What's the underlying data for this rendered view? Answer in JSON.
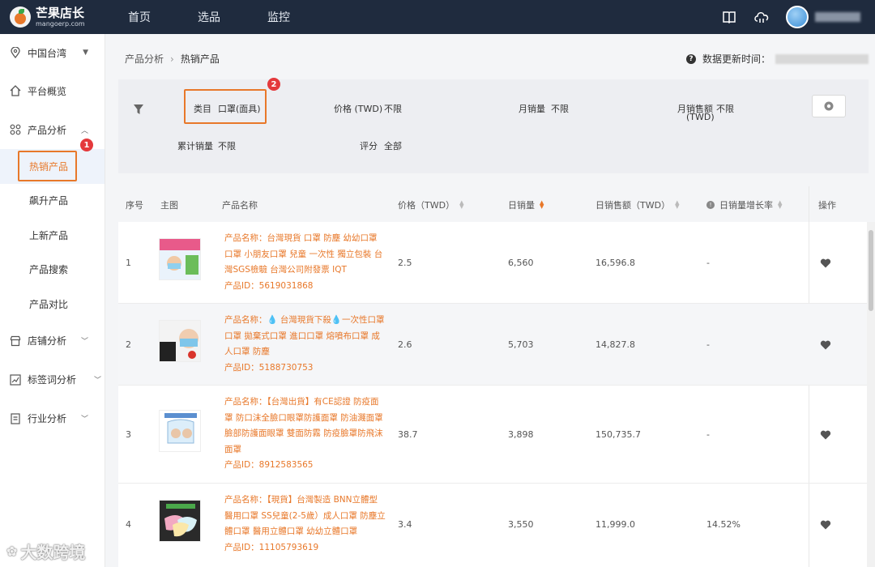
{
  "app": {
    "logo_cn": "芒果店长",
    "logo_en": "mangoerp.com",
    "nav": [
      "首页",
      "选品",
      "监控"
    ]
  },
  "sidebar": {
    "region": "中国台湾",
    "items": [
      {
        "label": "平台概览",
        "icon": "home-icon"
      },
      {
        "label": "产品分析",
        "icon": "grid-icon"
      },
      {
        "label": "店铺分析",
        "icon": "shop-icon"
      },
      {
        "label": "标签词分析",
        "icon": "chart-icon"
      },
      {
        "label": "行业分析",
        "icon": "report-icon"
      }
    ],
    "sub_items": [
      "热销产品",
      "飙升产品",
      "上新产品",
      "产品搜索",
      "产品对比"
    ]
  },
  "annotations": {
    "badge1": "1",
    "badge2": "2"
  },
  "breadcrumb": {
    "parent": "产品分析",
    "current": "热销产品"
  },
  "update_label": "数据更新时间：",
  "filters": {
    "category_label": "类目",
    "category_value": "口罩(面具)",
    "price_label": "价格 (TWD)",
    "price_value": "不限",
    "monthly_sales_label": "月销量",
    "monthly_sales_value": "不限",
    "monthly_revenue_label": "月销售额",
    "monthly_revenue_unit": "(TWD)",
    "monthly_revenue_value": "不限",
    "total_sales_label": "累计销量",
    "total_sales_value": "不限",
    "rating_label": "评分",
    "rating_value": "全部"
  },
  "table": {
    "headers": {
      "index": "序号",
      "image": "主图",
      "name": "产品名称",
      "price": "价格（TWD）",
      "daily_sales": "日销量",
      "daily_revenue": "日销售额（TWD）",
      "growth": "日销量增长率",
      "action": "操作"
    },
    "rows": [
      {
        "index": "1",
        "name_lines": [
          "产品名称：台灣現貨 口罩 防塵 幼幼口罩",
          "口罩 小朋友口罩 兒童 一次性 獨立包裝 台",
          "灣SGS檢驗 台灣公司附發票 IQT"
        ],
        "product_id": "产品ID：5619031868",
        "price": "2.5",
        "daily_sales": "6,560",
        "daily_revenue": "16,596.8",
        "growth": "-"
      },
      {
        "index": "2",
        "name_lines": [
          "产品名称：💧 台灣現貨下殺💧一次性口罩",
          "口罩 拋棄式口罩 進口口罩 熔噴布口罩 成",
          "人口罩 防塵"
        ],
        "product_id": "产品ID：5188730753",
        "price": "2.6",
        "daily_sales": "5,703",
        "daily_revenue": "14,827.8",
        "growth": "-"
      },
      {
        "index": "3",
        "name_lines": [
          "产品名称：【台灣出貨】有CE認證 防疫面",
          "罩 防口沫全臉口眼罩防護面罩 防油濺面罩",
          "臉部防護面眼罩 雙面防霧 防疫臉罩防飛沫",
          "面罩"
        ],
        "product_id": "产品ID：8912583565",
        "price": "38.7",
        "daily_sales": "3,898",
        "daily_revenue": "150,735.7",
        "growth": "-"
      },
      {
        "index": "4",
        "name_lines": [
          "产品名称：【現貨】台灣製造 BNN立體型",
          "醫用口罩 SS兒童(2-5歲）成人口罩 防塵立",
          "體口罩 醫用立體口罩 幼幼立體口罩"
        ],
        "product_id": "产品ID：11105793619",
        "price": "3.4",
        "daily_sales": "3,550",
        "daily_revenue": "11,999.0",
        "growth": "14.52%"
      }
    ]
  },
  "watermark": "大数跨境",
  "colors": {
    "accent": "#e8782a",
    "topbar": "#1f2b3e",
    "badge": "#e4393c"
  }
}
